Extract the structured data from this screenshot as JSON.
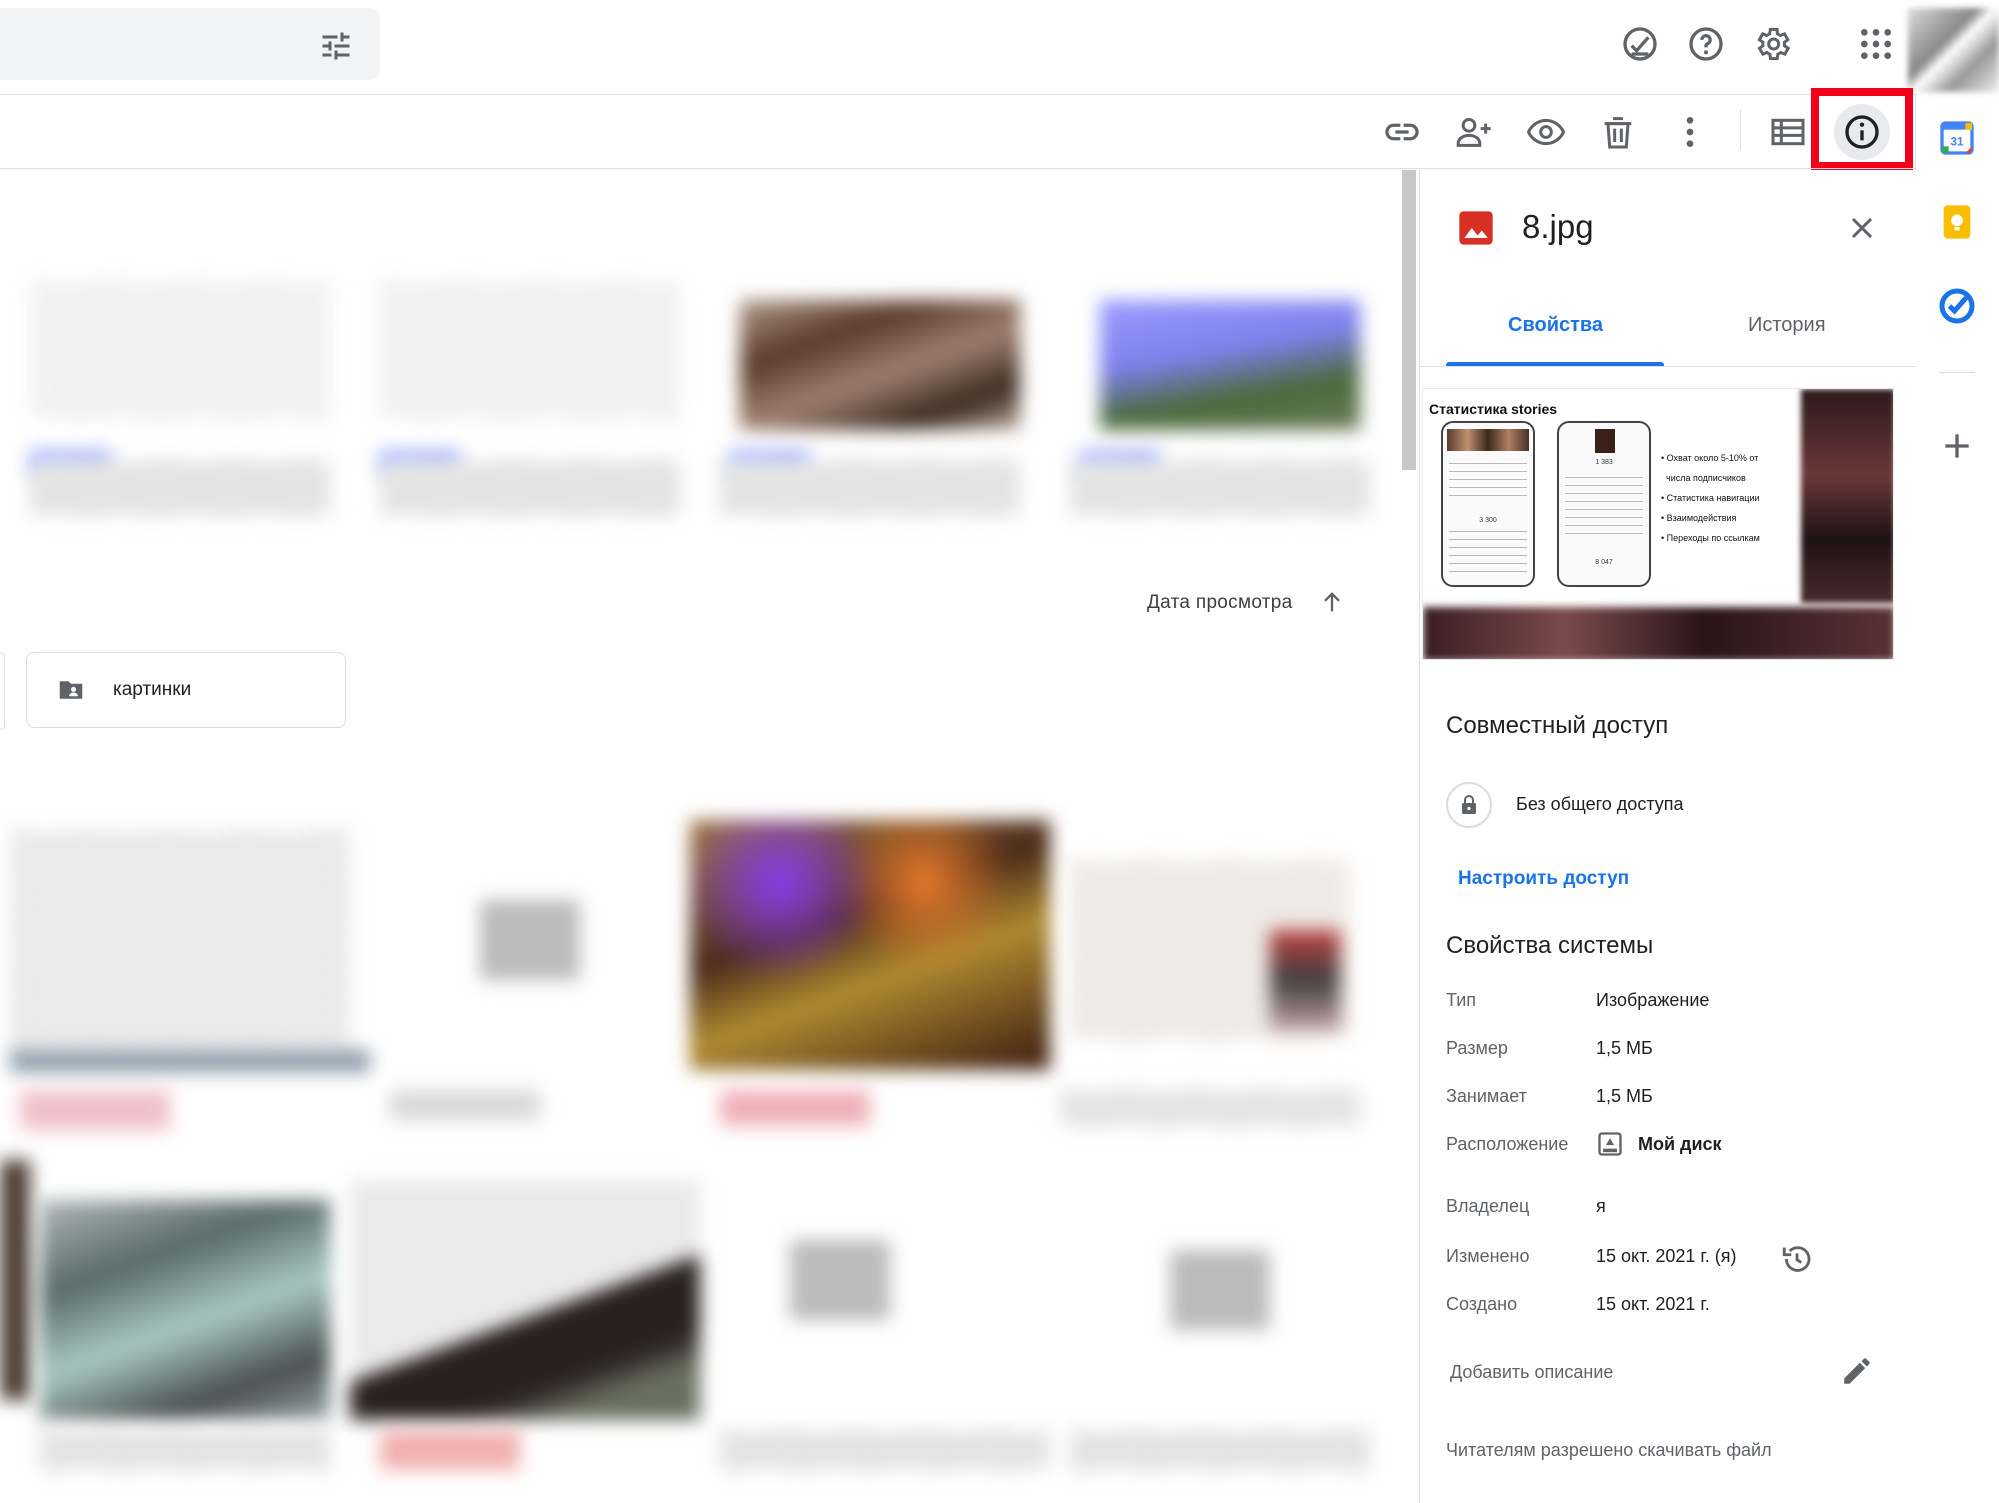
{
  "topbar": {
    "icons": [
      "filter-icon",
      "ready-for-offline-icon",
      "help-icon",
      "settings-icon",
      "apps-grid-icon"
    ]
  },
  "toolbar": {
    "icons": [
      "get-link-icon",
      "share-icon",
      "preview-icon",
      "trash-icon",
      "more-actions-icon",
      "list-view-icon",
      "details-info-icon"
    ]
  },
  "rail": {
    "icons": [
      "calendar-icon",
      "keep-icon",
      "tasks-icon",
      "add-icon"
    ],
    "calendar_day": "31"
  },
  "content": {
    "sort_label": "Дата просмотра",
    "folder_label": "картинки"
  },
  "details": {
    "file_name": "8.jpg",
    "tabs": [
      "Свойства",
      "История"
    ],
    "active_tab": "Свойства",
    "preview": {
      "title": "Статистика stories",
      "bullets": [
        "Охват около 5-10% от",
        "числа подписчиков",
        "Статистика навигации",
        "Взаимодействия",
        "Переходы по ссылкам"
      ],
      "phone_values": [
        "3 300",
        "1 383",
        "8 047"
      ]
    },
    "sharing": {
      "title": "Совместный доступ",
      "status": "Без общего доступа",
      "configure_link": "Настроить доступ"
    },
    "system": {
      "title": "Свойства системы",
      "rows": [
        {
          "label": "Тип",
          "value": "Изображение"
        },
        {
          "label": "Размер",
          "value": "1,5 МБ"
        },
        {
          "label": "Занимает",
          "value": "1,5 МБ"
        },
        {
          "label": "Расположение",
          "value": "Мой диск"
        },
        {
          "label": "Владелец",
          "value": "я"
        },
        {
          "label": "Изменено",
          "value": "15 окт. 2021 г. (я)"
        },
        {
          "label": "Создано",
          "value": "15 окт. 2021 г."
        }
      ]
    },
    "description_placeholder": "Добавить описание",
    "download_note": "Читателям разрешено скачивать файл"
  },
  "colors": {
    "accent": "#1a73e8",
    "highlight": "#f2001b",
    "file_icon": "#d93025"
  }
}
